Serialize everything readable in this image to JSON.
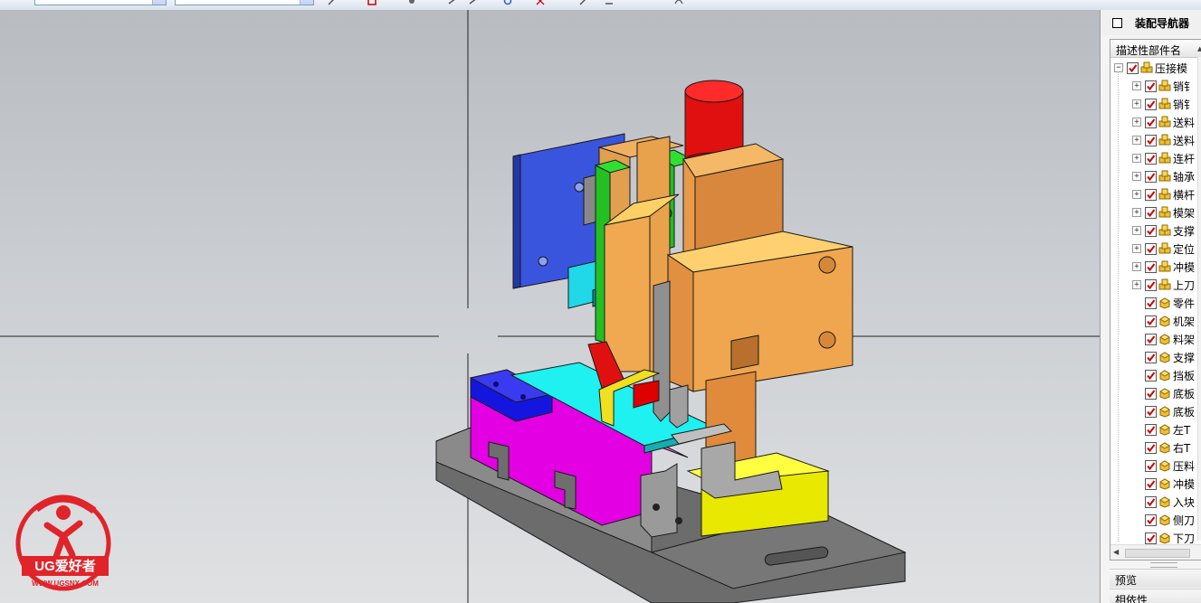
{
  "navigator": {
    "title": "装配导航器",
    "column_header": "描述性部件名",
    "rows": [
      {
        "label": "压接模",
        "level": 0,
        "expander": "−",
        "icon": "assembly-icon"
      },
      {
        "label": "销钅",
        "level": 1,
        "expander": "+",
        "icon": "assembly-icon"
      },
      {
        "label": "销钅",
        "level": 1,
        "expander": "+",
        "icon": "assembly-icon"
      },
      {
        "label": "送料",
        "level": 1,
        "expander": "+",
        "icon": "assembly-icon"
      },
      {
        "label": "送料",
        "level": 1,
        "expander": "+",
        "icon": "assembly-icon"
      },
      {
        "label": "连杆",
        "level": 1,
        "expander": "+",
        "icon": "assembly-icon"
      },
      {
        "label": "轴承",
        "level": 1,
        "expander": "+",
        "icon": "assembly-icon"
      },
      {
        "label": "横杆",
        "level": 1,
        "expander": "+",
        "icon": "assembly-icon"
      },
      {
        "label": "模架",
        "level": 1,
        "expander": "+",
        "icon": "assembly-icon"
      },
      {
        "label": "支撑",
        "level": 1,
        "expander": "+",
        "icon": "assembly-icon"
      },
      {
        "label": "定位",
        "level": 1,
        "expander": "+",
        "icon": "assembly-icon"
      },
      {
        "label": "冲模",
        "level": 1,
        "expander": "+",
        "icon": "assembly-icon"
      },
      {
        "label": "上刀",
        "level": 1,
        "expander": "+",
        "icon": "assembly-icon"
      },
      {
        "label": "零件",
        "level": 1,
        "expander": "",
        "icon": "part-icon"
      },
      {
        "label": "机架",
        "level": 1,
        "expander": "",
        "icon": "part-icon"
      },
      {
        "label": "料架",
        "level": 1,
        "expander": "",
        "icon": "part-icon"
      },
      {
        "label": "支撑",
        "level": 1,
        "expander": "",
        "icon": "part-icon"
      },
      {
        "label": "挡板",
        "level": 1,
        "expander": "",
        "icon": "part-icon"
      },
      {
        "label": "底板",
        "level": 1,
        "expander": "",
        "icon": "part-icon"
      },
      {
        "label": "底板",
        "level": 1,
        "expander": "",
        "icon": "part-icon"
      },
      {
        "label": "左T",
        "level": 1,
        "expander": "",
        "icon": "part-icon"
      },
      {
        "label": "右T",
        "level": 1,
        "expander": "",
        "icon": "part-icon"
      },
      {
        "label": "压料",
        "level": 1,
        "expander": "",
        "icon": "part-icon"
      },
      {
        "label": "冲模",
        "level": 1,
        "expander": "",
        "icon": "part-icon"
      },
      {
        "label": "入块",
        "level": 1,
        "expander": "",
        "icon": "part-icon"
      },
      {
        "label": "侧刀",
        "level": 1,
        "expander": "",
        "icon": "part-icon"
      },
      {
        "label": "下刀",
        "level": 1,
        "expander": "",
        "icon": "part-icon"
      }
    ],
    "preview_label": "预览",
    "dependency_label": "相依性"
  },
  "watermark": {
    "brand": "UG爱好者",
    "url": "WWW.UGSNX.COM"
  },
  "colors": {
    "viewport_top": "#b8bcc1",
    "viewport_bottom": "#dfe1e3",
    "check_red": "#d00000",
    "logo_red": "#e0242a"
  }
}
